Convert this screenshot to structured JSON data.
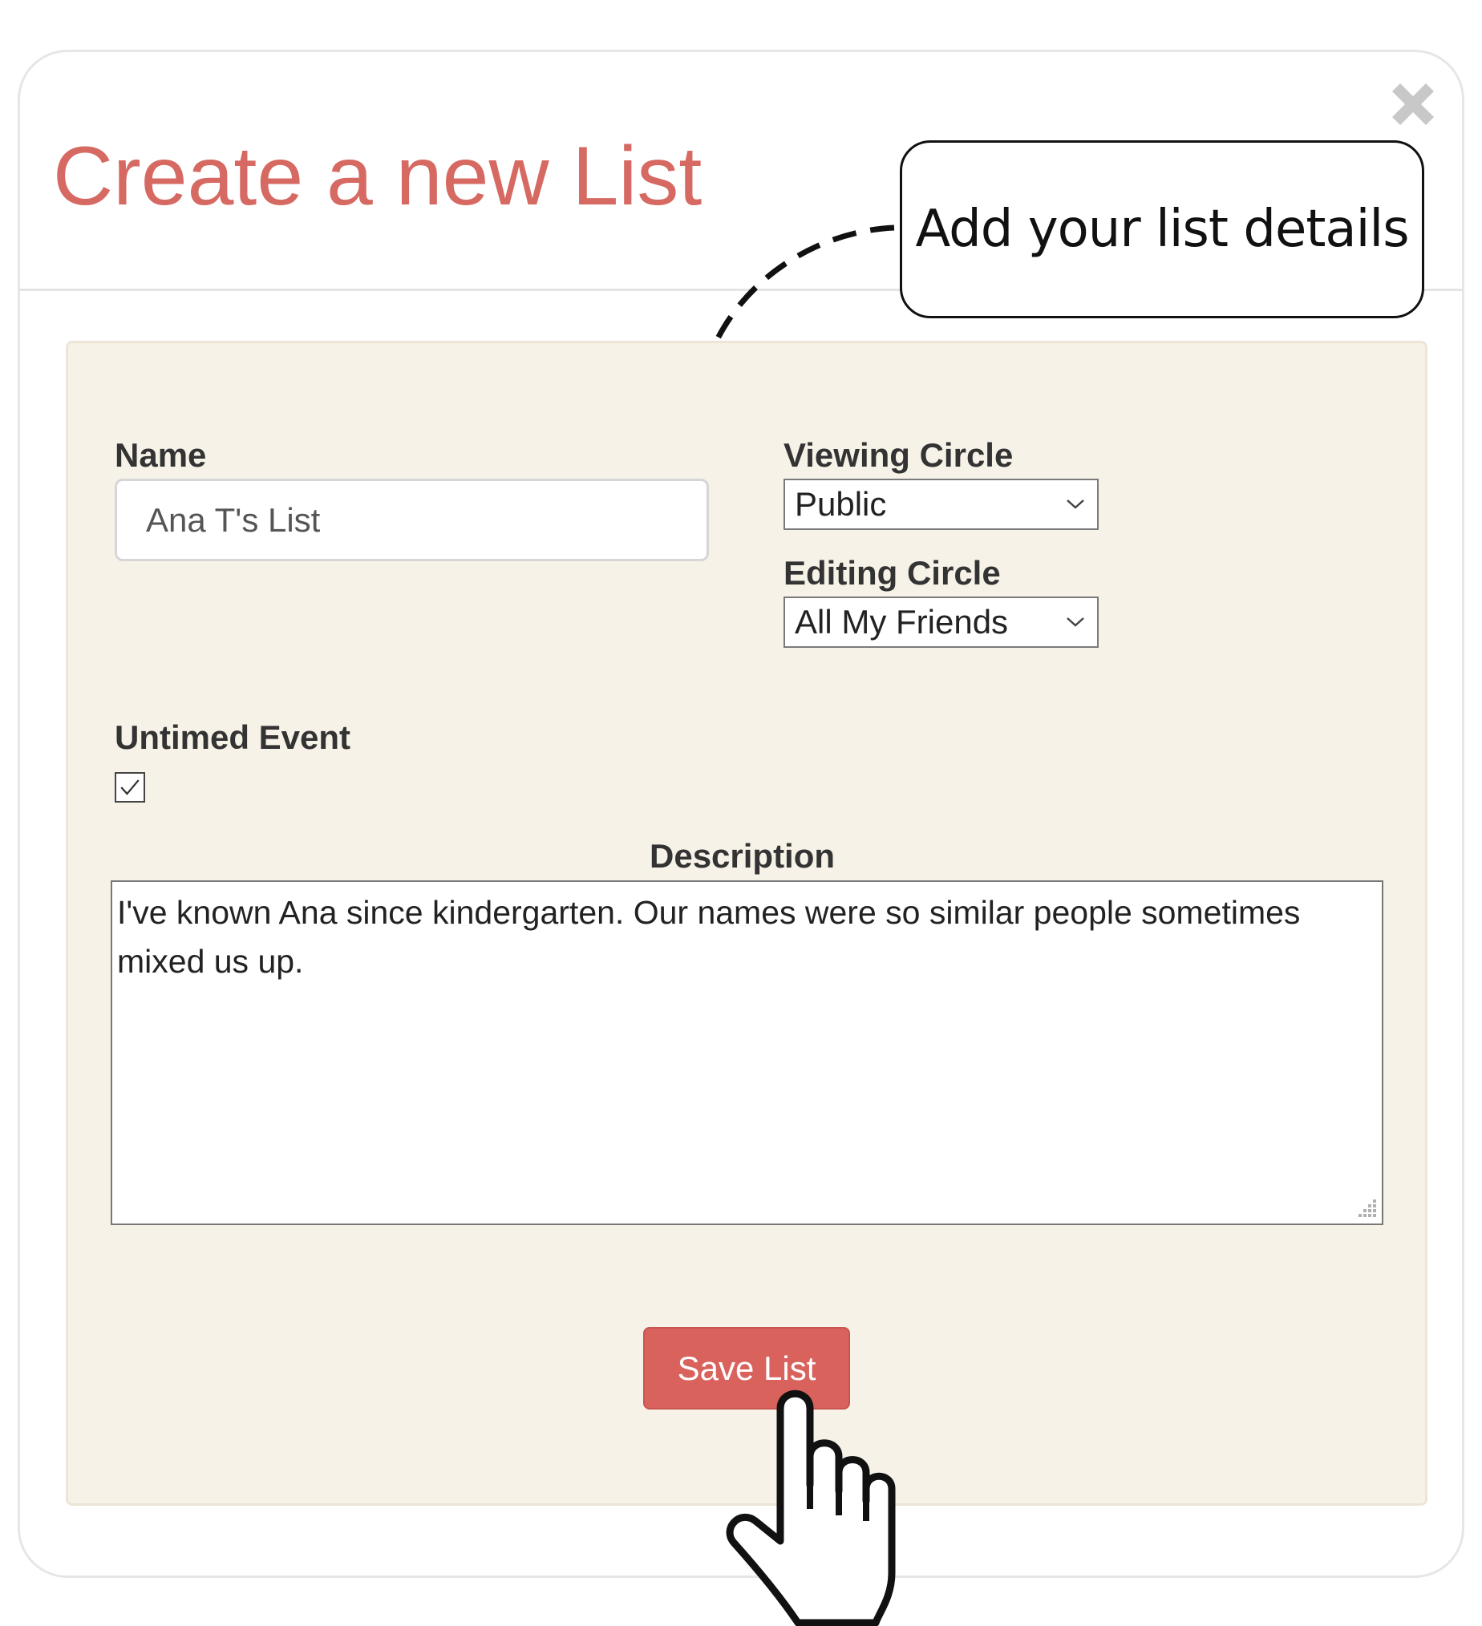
{
  "modal": {
    "title": "Create a new List",
    "close_icon": "close-x-icon"
  },
  "callout": {
    "text": "Add your list details",
    "arrow_icon": "dashed-curved-arrow-icon"
  },
  "form": {
    "name": {
      "label": "Name",
      "value": "Ana T's List"
    },
    "viewing_circle": {
      "label": "Viewing Circle",
      "selected": "Public"
    },
    "editing_circle": {
      "label": "Editing Circle",
      "selected": "All My Friends"
    },
    "untimed_event": {
      "label": "Untimed Event",
      "checked": true
    },
    "description": {
      "label": "Description",
      "value": "I've known Ana since kindergarten. Our names were so similar people sometimes mixed us up."
    },
    "save_button": {
      "label": "Save List"
    }
  },
  "cursor": {
    "icon": "pointing-hand-cursor-icon"
  },
  "colors": {
    "title": "#d66961",
    "save_button_bg": "#d9625c",
    "panel_bg": "#f7f2e8",
    "close_icon": "#c8c8c8"
  }
}
